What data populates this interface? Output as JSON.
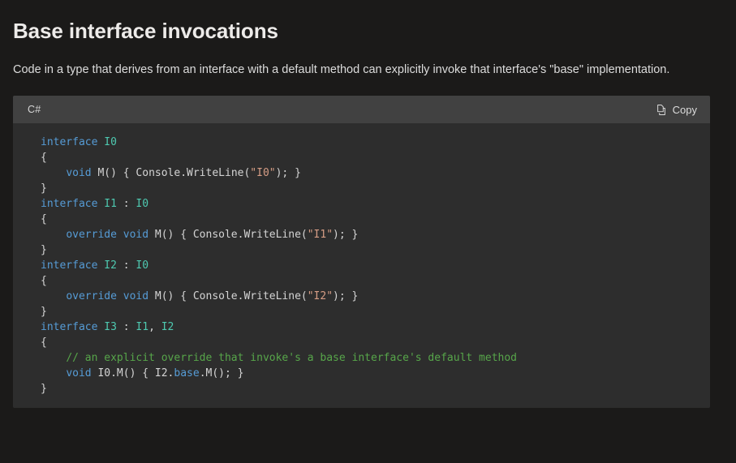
{
  "page": {
    "title": "Base interface invocations",
    "intro": "Code in a type that derives from an interface with a default method can explicitly invoke that interface's \"base\" implementation.",
    "background_color": "#1b1a19"
  },
  "codeblock": {
    "language_label": "C#",
    "copy_label": "Copy",
    "copy_icon": "copy-pages-icon",
    "header_bg": "#414141",
    "body_bg": "#2d2d2d",
    "syntax_colors": {
      "keyword": "#569cd6",
      "type": "#4ec9b0",
      "string": "#d69d85",
      "comment": "#57a64a",
      "plain": "#d4d4d4"
    },
    "lines": [
      [
        {
          "t": "interface ",
          "c": "kw"
        },
        {
          "t": "I0",
          "c": "type"
        }
      ],
      [
        {
          "t": "{",
          "c": "plain"
        }
      ],
      [
        {
          "t": "    ",
          "c": "plain"
        },
        {
          "t": "void ",
          "c": "kw"
        },
        {
          "t": "M() { Console.WriteLine(",
          "c": "plain"
        },
        {
          "t": "\"I0\"",
          "c": "str"
        },
        {
          "t": "); }",
          "c": "plain"
        }
      ],
      [
        {
          "t": "}",
          "c": "plain"
        }
      ],
      [
        {
          "t": "interface ",
          "c": "kw"
        },
        {
          "t": "I1",
          "c": "type"
        },
        {
          "t": " : ",
          "c": "plain"
        },
        {
          "t": "I0",
          "c": "type"
        }
      ],
      [
        {
          "t": "{",
          "c": "plain"
        }
      ],
      [
        {
          "t": "    ",
          "c": "plain"
        },
        {
          "t": "override void ",
          "c": "kw"
        },
        {
          "t": "M() { Console.WriteLine(",
          "c": "plain"
        },
        {
          "t": "\"I1\"",
          "c": "str"
        },
        {
          "t": "); }",
          "c": "plain"
        }
      ],
      [
        {
          "t": "}",
          "c": "plain"
        }
      ],
      [
        {
          "t": "interface ",
          "c": "kw"
        },
        {
          "t": "I2",
          "c": "type"
        },
        {
          "t": " : ",
          "c": "plain"
        },
        {
          "t": "I0",
          "c": "type"
        }
      ],
      [
        {
          "t": "{",
          "c": "plain"
        }
      ],
      [
        {
          "t": "    ",
          "c": "plain"
        },
        {
          "t": "override void ",
          "c": "kw"
        },
        {
          "t": "M() { Console.WriteLine(",
          "c": "plain"
        },
        {
          "t": "\"I2\"",
          "c": "str"
        },
        {
          "t": "); }",
          "c": "plain"
        }
      ],
      [
        {
          "t": "}",
          "c": "plain"
        }
      ],
      [
        {
          "t": "interface ",
          "c": "kw"
        },
        {
          "t": "I3",
          "c": "type"
        },
        {
          "t": " : ",
          "c": "plain"
        },
        {
          "t": "I1",
          "c": "type"
        },
        {
          "t": ", ",
          "c": "plain"
        },
        {
          "t": "I2",
          "c": "type"
        }
      ],
      [
        {
          "t": "{",
          "c": "plain"
        }
      ],
      [
        {
          "t": "    ",
          "c": "plain"
        },
        {
          "t": "// an explicit override that invoke's a base interface's default method",
          "c": "comment"
        }
      ],
      [
        {
          "t": "    ",
          "c": "plain"
        },
        {
          "t": "void ",
          "c": "kw"
        },
        {
          "t": "I0.M() { I2.",
          "c": "plain"
        },
        {
          "t": "base",
          "c": "kw"
        },
        {
          "t": ".M(); }",
          "c": "plain"
        }
      ],
      [
        {
          "t": "}",
          "c": "plain"
        }
      ]
    ]
  }
}
